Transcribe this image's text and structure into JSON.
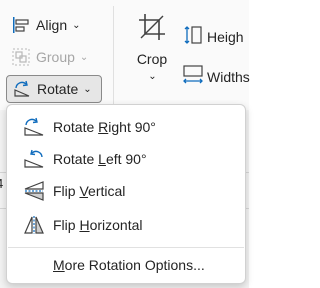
{
  "ribbon": {
    "align": {
      "label": "Align",
      "icon": "align-icon"
    },
    "group": {
      "label": "Group",
      "icon": "group-icon",
      "disabled": true
    },
    "rotate": {
      "label": "Rotate",
      "icon": "rotate-icon"
    },
    "crop": {
      "label": "Crop",
      "icon": "crop-icon"
    },
    "height": {
      "label": "Heigh",
      "icon": "height-icon"
    },
    "width": {
      "label": "Widths",
      "icon": "width-icon"
    }
  },
  "colors": {
    "accent": "#0f6cbd",
    "text": "#242424",
    "disabled": "#a6a6a6"
  },
  "left_edge_char": "4",
  "menu": {
    "items": [
      {
        "pre": "Rotate ",
        "key": "R",
        "post": "ight 90°",
        "icon": "rotate-right-icon"
      },
      {
        "pre": "Rotate ",
        "key": "L",
        "post": "eft 90°",
        "icon": "rotate-left-icon"
      },
      {
        "pre": "Flip ",
        "key": "V",
        "post": "ertical",
        "icon": "flip-vertical-icon"
      },
      {
        "pre": "Flip ",
        "key": "H",
        "post": "orizontal",
        "icon": "flip-horizontal-icon"
      }
    ],
    "more": {
      "pre": "",
      "key": "M",
      "post": "ore Rotation Options..."
    }
  }
}
